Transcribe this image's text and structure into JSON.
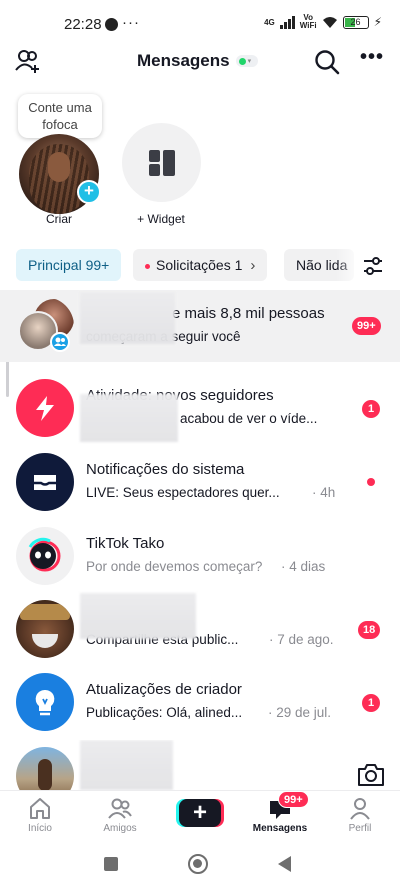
{
  "status_bar": {
    "time": "22:28",
    "more": "···",
    "network": "4G",
    "volte": "Vo\nWiFi",
    "battery": "26"
  },
  "header": {
    "title": "Mensagens",
    "online_indicator_color": "#20d56a"
  },
  "stories": {
    "bubble_text": "Conte uma fofoca",
    "create_label": "Criar",
    "widget_label": "+ Widget"
  },
  "tabs": [
    {
      "label": "Principal 99+",
      "active": true
    },
    {
      "label": "Solicitações 1",
      "active": false
    },
    {
      "label": "Não lida",
      "active": false
    }
  ],
  "conversations": [
    {
      "title": "e mais 8,8 mil pessoas",
      "subtitle": "começaram a seguir você",
      "time": "",
      "badge": "99+"
    },
    {
      "title": "Atividade: novos seguidores",
      "subtitle": "acabou de ver o víde...",
      "time": "",
      "badge": "1"
    },
    {
      "title": "Notificações do sistema",
      "subtitle": "LIVE: Seus espectadores quer...",
      "time": "· 4h",
      "badge": ""
    },
    {
      "title": "TikTok Tako",
      "subtitle": "Por onde devemos começar?",
      "time": "· 4 dias",
      "badge": ""
    },
    {
      "title": "",
      "subtitle": "Compartilhe esta public...",
      "time": "· 7 de ago.",
      "badge": "18"
    },
    {
      "title": "Atualizações de criador",
      "subtitle": "Publicações: Olá, alined...",
      "time": "· 29 de jul.",
      "badge": "1"
    },
    {
      "title": "",
      "subtitle": "",
      "time": "",
      "badge": ""
    }
  ],
  "bottom_nav": {
    "home": "Início",
    "friends": "Amigos",
    "create": "+",
    "messages": "Mensagens",
    "messages_badge": "99+",
    "profile": "Perfil"
  },
  "colors": {
    "accent_red": "#fe2c55",
    "tab_active_bg": "#e1f4fb",
    "tab_active_text": "#0e5f86",
    "activity_icon_bg": "#fe2c55",
    "system_icon_bg": "#0f1a3a",
    "creator_icon_bg": "#1a7fe0"
  }
}
